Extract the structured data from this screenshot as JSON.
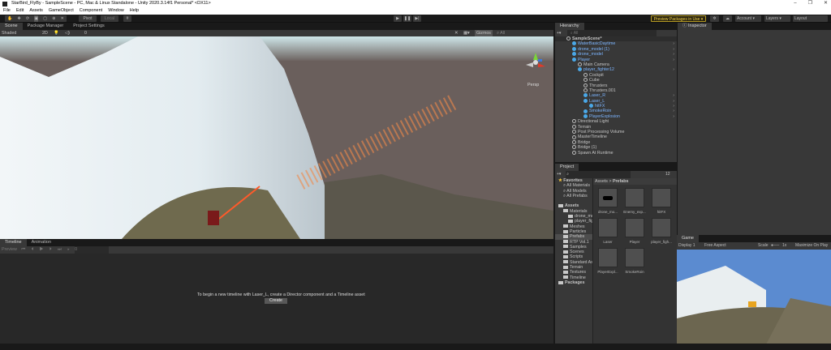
{
  "window": {
    "title": "StarBird_FlyBy - SampleScene - PC, Mac & Linux Standalone - Unity 2020.3.14f1 Personal* <DX11>",
    "controls": [
      "–",
      "❐",
      "✕"
    ]
  },
  "menu": [
    "File",
    "Edit",
    "Assets",
    "GameObject",
    "Component",
    "Window",
    "Help"
  ],
  "toolbar": {
    "pivot": "Pivot",
    "local": "Local",
    "preview_packages": "Preview Packages in Use",
    "account": "Account",
    "layers": "Layers",
    "layout": "Layout"
  },
  "scene": {
    "tabs": [
      "Scene",
      "Package Manager",
      "Project Settings"
    ],
    "shading": "Shaded",
    "mode_2d": "2D",
    "gizmos": "Gizmos",
    "search_all": "All",
    "persp": "Persp",
    "hidden_count": "0"
  },
  "hierarchy": {
    "title": "Hierarchy",
    "search": "All",
    "items": [
      {
        "label": "SampleScene*",
        "level": 0,
        "kind": "scene"
      },
      {
        "label": "WaterBasicDaytime",
        "level": 1,
        "kind": "prefab",
        "chev": true
      },
      {
        "label": "drone_model (1)",
        "level": 1,
        "kind": "prefab",
        "chev": true
      },
      {
        "label": "drone_model",
        "level": 1,
        "kind": "prefab",
        "chev": true
      },
      {
        "label": "Player",
        "level": 1,
        "kind": "prefab",
        "chev": true
      },
      {
        "label": "Main Camera",
        "level": 2,
        "kind": "obj"
      },
      {
        "label": "player_fighter12",
        "level": 2,
        "kind": "prefab",
        "chev": true
      },
      {
        "label": "Cockpit",
        "level": 3,
        "kind": "obj"
      },
      {
        "label": "Cube",
        "level": 3,
        "kind": "obj"
      },
      {
        "label": "Thrusters",
        "level": 3,
        "kind": "obj"
      },
      {
        "label": "Thrusters.001",
        "level": 3,
        "kind": "obj"
      },
      {
        "label": "Laser_R",
        "level": 3,
        "kind": "prefab",
        "chev": true
      },
      {
        "label": "Laser_L",
        "level": 3,
        "kind": "prefab",
        "chev": true
      },
      {
        "label": "hitFX",
        "level": 4,
        "kind": "prefab",
        "chev": true
      },
      {
        "label": "SmokeRoin",
        "level": 3,
        "kind": "prefab",
        "chev": true
      },
      {
        "label": "PlayerExplosion",
        "level": 3,
        "kind": "prefab",
        "chev": true
      },
      {
        "label": "Directional Light",
        "level": 1,
        "kind": "gobj"
      },
      {
        "label": "Terrain",
        "level": 1,
        "kind": "gobj"
      },
      {
        "label": "Post Processing Volume",
        "level": 1,
        "kind": "gobj"
      },
      {
        "label": "MasterTimeline",
        "level": 1,
        "kind": "gobj"
      },
      {
        "label": "Bridge",
        "level": 1,
        "kind": "gobj"
      },
      {
        "label": "Bridge (1)",
        "level": 1,
        "kind": "gobj"
      },
      {
        "label": "Spawn At Runtime",
        "level": 1,
        "kind": "gobj"
      }
    ]
  },
  "project": {
    "title": "Project",
    "hidden_count": "12",
    "breadcrumb": [
      "Assets",
      "Prefabs"
    ],
    "tree": [
      {
        "label": "Favorites",
        "level": 0,
        "bold": true
      },
      {
        "label": "All Materials",
        "level": 1,
        "search": true
      },
      {
        "label": "All Models",
        "level": 1,
        "search": true
      },
      {
        "label": "All Prefabs",
        "level": 1,
        "search": true
      },
      {
        "label": "",
        "level": 0
      },
      {
        "label": "Assets",
        "level": 0,
        "bold": true
      },
      {
        "label": "Materials",
        "level": 1
      },
      {
        "label": "drone_mo",
        "level": 2
      },
      {
        "label": "player_fig",
        "level": 2
      },
      {
        "label": "Meshes",
        "level": 1
      },
      {
        "label": "Particles",
        "level": 1
      },
      {
        "label": "Prefabs",
        "level": 1,
        "selected": true
      },
      {
        "label": "RTP Vol.1",
        "level": 1
      },
      {
        "label": "Samples",
        "level": 1
      },
      {
        "label": "Scenes",
        "level": 1
      },
      {
        "label": "Scripts",
        "level": 1
      },
      {
        "label": "Standard As",
        "level": 1
      },
      {
        "label": "Terrain",
        "level": 1
      },
      {
        "label": "Textures",
        "level": 1
      },
      {
        "label": "Timeline",
        "level": 1
      },
      {
        "label": "Packages",
        "level": 0,
        "bold": true
      }
    ],
    "assets": [
      "drone_mo...",
      "Enemy_exp...",
      "hitFX",
      "Laser",
      "Player",
      "player_figh...",
      "PlayerExpl...",
      "SmokeRoin"
    ]
  },
  "inspector": {
    "title": "Inspector"
  },
  "timeline": {
    "tabs": [
      "Timeline",
      "Animation"
    ],
    "preview": "Preview",
    "frame": "0",
    "message": "To begin a new timeline with Laser_L, create a Director component and a Timeline asset",
    "create": "Create"
  },
  "game": {
    "title": "Game",
    "display": "Display 1",
    "aspect": "Free Aspect",
    "scale_label": "Scale",
    "scale_value": "1x",
    "maximize": "Maximize On Play"
  }
}
